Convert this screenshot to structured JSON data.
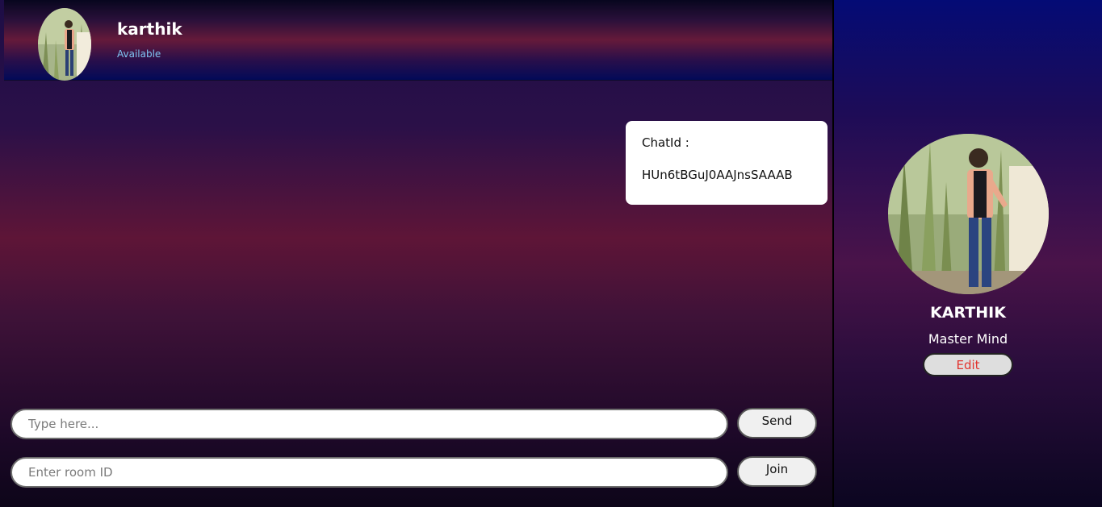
{
  "header": {
    "contact_name": "karthik",
    "contact_status": "Available"
  },
  "messages": [
    {
      "label": "ChatId :",
      "value": "HUn6tBGuJ0AAJnsSAAAB"
    }
  ],
  "composer": {
    "message_placeholder": "Type here...",
    "send_label": "Send"
  },
  "room": {
    "room_placeholder": "Enter room ID",
    "join_label": "Join"
  },
  "profile": {
    "name": "KARTHIK",
    "bio": "Master Mind",
    "edit_label": "Edit"
  },
  "colors": {
    "status": "#7fc4f2",
    "edit_text": "#e2332e"
  }
}
